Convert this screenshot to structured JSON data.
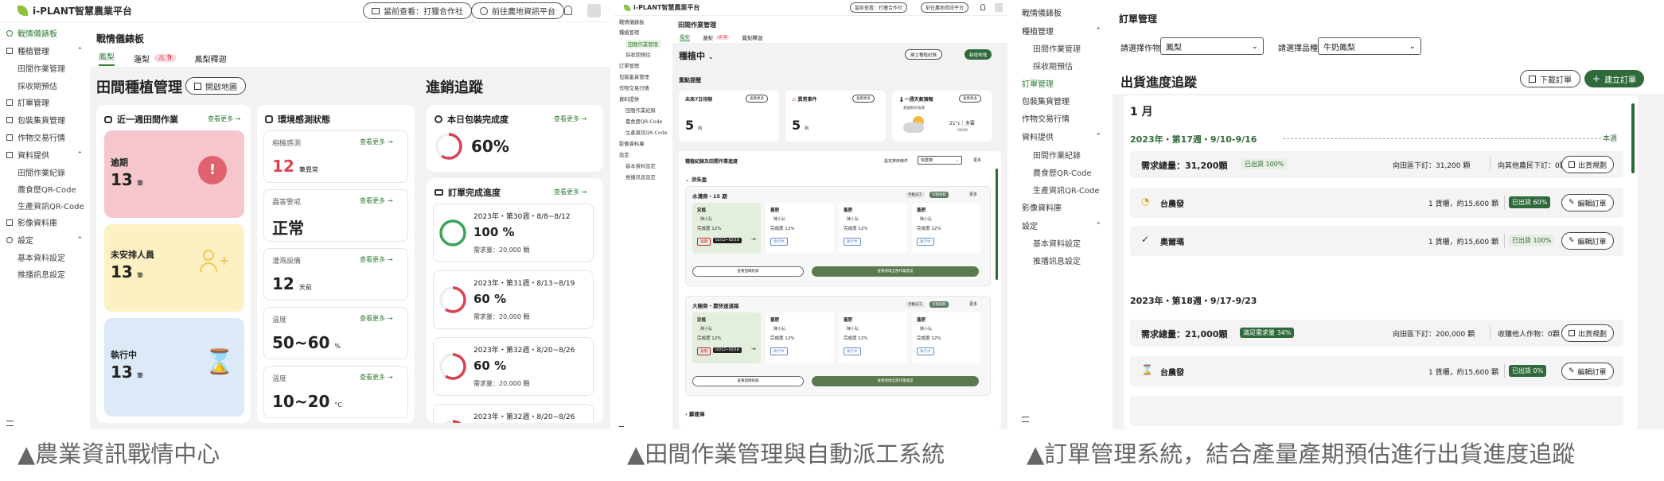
{
  "brand": "i-PLANT智慧農業平台",
  "top": {
    "current": "當前查看：打獵合作社",
    "platform": "前往農地資訊平台"
  },
  "captions": [
    "▲農業資訊戰情中心",
    "▲田間作業管理與自動派工系統",
    "▲訂單管理系統，結合產量產期預估進行出貨進度追蹤"
  ],
  "sidebar": {
    "dashboard": "戰情儀錶板",
    "planting": "種植管理",
    "field_ops": "田間作業管理",
    "harvest": "採收期預估",
    "order": "訂單管理",
    "packing": "包裝集貨管理",
    "trade": "作物交易行情",
    "data": "資料提供",
    "field_records": "田間作業紀錄",
    "qr_farm": "農食歷QR-Code",
    "qr_prod": "生產資訊QR-Code",
    "image_db": "影像資料庫",
    "settings": "設定",
    "basic": "基本資料設定",
    "notify": "推播訊息設定"
  },
  "p1": {
    "title": "戰情儀錶板",
    "tabs": [
      "鳳梨",
      "蓮梨",
      "鳳梨釋迦"
    ],
    "tab_badge": "9",
    "sec1": "田間種植管理",
    "open_map": "開啟地圖",
    "sec2": "進銷追蹤",
    "weekly": "近一週田間作業",
    "env": "環境感測狀態",
    "more": "查看更多",
    "overdue": {
      "label": "逾期",
      "num": "13",
      "unit": "筆"
    },
    "unassigned": {
      "label": "未安排人員",
      "num": "13",
      "unit": "筆"
    },
    "running": {
      "label": "執行中",
      "num": "13",
      "unit": "筆"
    },
    "sensors": [
      {
        "name": "相機感測",
        "value": "12",
        "unit": "筆異常"
      },
      {
        "name": "蟲害警戒",
        "value": "正常",
        "unit": ""
      },
      {
        "name": "灌溉設備",
        "value": "12",
        "unit": "天前"
      },
      {
        "name": "溫度",
        "value": "50~60",
        "unit": "%"
      },
      {
        "name": "溫度",
        "value": "10~20",
        "unit": "°C"
      }
    ],
    "pack": {
      "title": "本日包裝完成度",
      "value": "60%"
    },
    "orders": {
      "title": "訂單完成進度",
      "items": [
        {
          "week": "2023年・第30週・8/8~8/12",
          "pct": "100 %",
          "need": "需求量：20,000 顆",
          "frac": 1.0,
          "color": "#3aa35b"
        },
        {
          "week": "2023年・第31週・8/13~8/19",
          "pct": "60 %",
          "need": "需求量：20,000 顆",
          "frac": 0.6,
          "color": "#d9424f"
        },
        {
          "week": "2023年・第32週・8/20~8/26",
          "pct": "60 %",
          "need": "需求量：20,000 顆",
          "frac": 0.6,
          "color": "#d9424f"
        },
        {
          "week": "2023年・第32週・8/20~8/26",
          "pct": "",
          "need": "",
          "frac": 0.6,
          "color": "#d9424f"
        }
      ]
    }
  },
  "p2": {
    "title": "田間作業管理",
    "tabs": [
      "鳳梨",
      "蓮梨",
      "鳳梨釋迦"
    ],
    "tab_badge": "9",
    "status": "種植中",
    "btn_record": "建立種植紀錄",
    "btn_add": "新增地塊",
    "focus": "重點提醒",
    "cards": [
      {
        "title": "未來7日待辦",
        "more": "查看更多",
        "num": "5",
        "unit": "則"
      },
      {
        "title": "異常事件",
        "more": "查看更多",
        "num": "5",
        "unit": "則"
      },
      {
        "title": "一週天氣預報",
        "more": "查看更多",
        "loc": "嘉義縣民雄鄉",
        "temp": "21°c｜多雲",
        "date": "09/06"
      }
    ],
    "table_title": "種植紀錄及田間作業進度",
    "filter_label": "設定排序條件",
    "filter_value": "依農場",
    "more2": "更多",
    "group1": "洪朱盈",
    "group2": "蘇建偉",
    "fields": [
      {
        "name": "水溝旁・15 期",
        "tags": [
          "手動派工",
          "切割排程"
        ],
        "view": "查看田間紀錄",
        "all": "查看地塊全部作業進度"
      },
      {
        "name": "大樹旁・靠快速道路",
        "tags": [
          "手動派工",
          "切割排程"
        ],
        "view": "查看田間紀錄",
        "all": "查看地塊全部作業進度"
      }
    ],
    "task": {
      "label": "定植",
      "person": "陳小弘",
      "progress": "完成度 12%",
      "tag1": "逾期",
      "date": "02/12~02/18",
      "tag2": "執行中"
    },
    "task2": {
      "label": "蓋肥",
      "person": "陳小弘",
      "progress": "完成度 12%",
      "tag": "執行中"
    }
  },
  "p3": {
    "title": "訂單管理",
    "crop_label": "請選擇作物",
    "crop": "鳳梨",
    "variety_label": "請選擇品種",
    "variety": "牛奶鳳梨",
    "section": "出貨進度追蹤",
    "download": "下載訂單",
    "create": "建立訂單",
    "month": "1 月",
    "week1": "2023年・第17週・9/10-9/16",
    "this_week": "本週",
    "total1": "需求總量：31,200顆",
    "total1_badge": "已出貨 100%",
    "total1_from": "向田區下訂：31,200 顆",
    "total1_other": "向其他農民下訂：0顆",
    "plan": "出貨規劃",
    "orders1": [
      {
        "name": "台農發",
        "qty": "1 貨櫃，約15,600 顆",
        "badge": "已出貨 60%",
        "edit": "編輯訂單",
        "icon": "clock"
      },
      {
        "name": "奧爾瑪",
        "qty": "1 貨櫃，約15,600 顆",
        "badge": "已出貨 100%",
        "edit": "編輯訂單",
        "icon": "check"
      }
    ],
    "week2": "2023年・第18週・9/17-9/23",
    "total2": "需求總量：21,000顆",
    "total2_badge": "滿足需求量 34%",
    "total2_from": "向田區下訂：200,000 顆",
    "total2_other": "收購他人作物：0顆",
    "orders2": [
      {
        "name": "台農發",
        "qty": "1 貨櫃，約15,600 顆",
        "badge": "已出貨 0%",
        "edit": "編輯訂單",
        "icon": "hourglass"
      }
    ]
  },
  "colors": {
    "green": "#2f6b3a",
    "leaf": "#8fc33f",
    "pink": "#f5c6cc",
    "yellow": "#fdf0c2",
    "blue": "#dce9f7",
    "red": "#e0626f"
  }
}
